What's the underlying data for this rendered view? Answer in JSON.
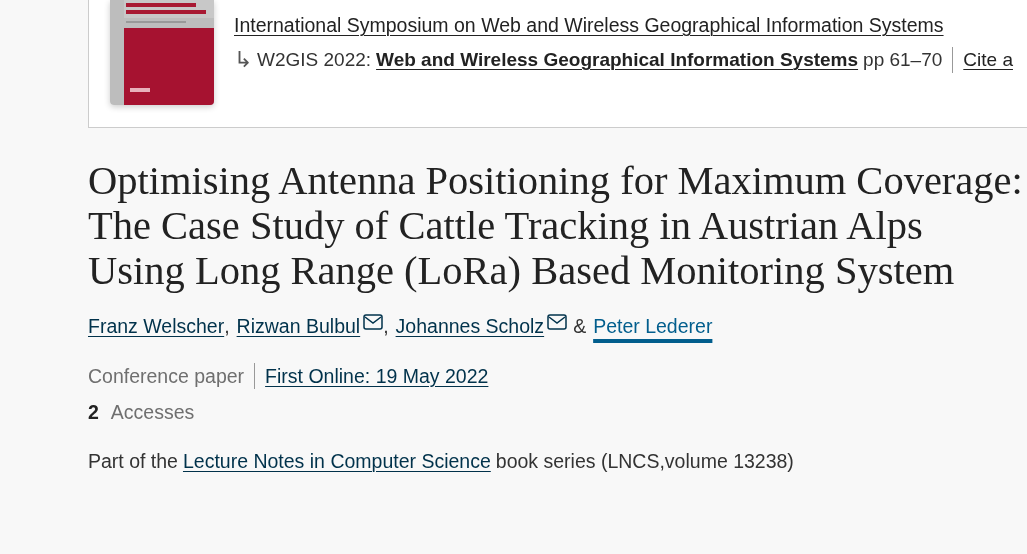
{
  "book": {
    "conference": "International Symposium on Web and Wireless Geographical Information Systems",
    "arrow": "↳",
    "event": "W2GIS 2022:",
    "book_title": "Web and Wireless Geographical Information Systems",
    "pages": "pp 61–70",
    "cite": "Cite a"
  },
  "title": "Optimising Antenna Positioning for Maximum Coverage: The Case Study of Cattle Tracking in Austrian Alps Using Long Range (LoRa) Based Monitoring System",
  "authors": [
    {
      "name": "Franz Welscher",
      "email": false,
      "focused": false,
      "separator": ","
    },
    {
      "name": "Rizwan Bulbul",
      "email": true,
      "focused": false,
      "separator": ","
    },
    {
      "name": "Johannes Scholz",
      "email": true,
      "focused": false,
      "separator": "&"
    },
    {
      "name": "Peter Lederer",
      "email": false,
      "focused": true
    }
  ],
  "meta": {
    "type": "Conference paper",
    "first_online": "First Online: 19 May 2022"
  },
  "accesses": {
    "count": "2",
    "label": "Accesses"
  },
  "series": {
    "prefix": "Part of the",
    "link": "Lecture Notes in Computer Science",
    "suffix": "book series (LNCS,volume 13238)"
  }
}
